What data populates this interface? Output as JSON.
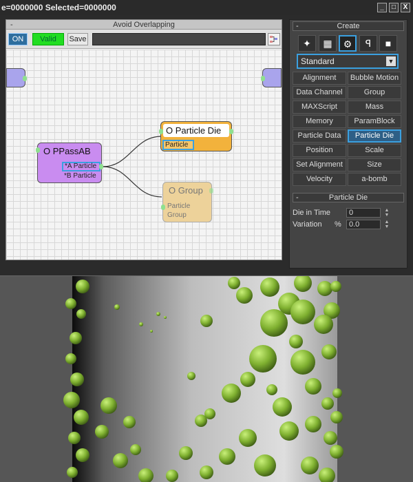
{
  "window": {
    "status_text": "e=0000000  Selected=0000000",
    "buttons": [
      "_",
      "□",
      "X"
    ]
  },
  "editor": {
    "title": "Avoid Overlapping",
    "collapse_symbol": "-",
    "on_label": "ON",
    "valid_label": "Valid",
    "save_label": "Save",
    "field_value": ""
  },
  "nodes": {
    "pass": {
      "title": "O PPassAB",
      "port_a": "*A Particle",
      "port_b": "*B Particle"
    },
    "die": {
      "title": "O Particle Die",
      "port": "Particle"
    },
    "group": {
      "title": "O Group",
      "port_line1": "Particle",
      "port_line2": "Group"
    }
  },
  "create": {
    "title": "Create",
    "collapse_symbol": "-",
    "icons": [
      "particle-icon",
      "table-icon",
      "gear-icon",
      "wrench-icon",
      "cube-icon"
    ],
    "dropdown_value": "Standard",
    "operators": [
      {
        "label": "Alignment",
        "selected": false
      },
      {
        "label": "Bubble Motion",
        "selected": false
      },
      {
        "label": "Data Channel",
        "selected": false
      },
      {
        "label": "Group",
        "selected": false
      },
      {
        "label": "MAXScript",
        "selected": false
      },
      {
        "label": "Mass",
        "selected": false
      },
      {
        "label": "Memory",
        "selected": false
      },
      {
        "label": "ParamBlock",
        "selected": false
      },
      {
        "label": "Particle Data",
        "selected": false
      },
      {
        "label": "Particle Die",
        "selected": true
      },
      {
        "label": "Position",
        "selected": false
      },
      {
        "label": "Scale",
        "selected": false
      },
      {
        "label": "Set Alignment",
        "selected": false
      },
      {
        "label": "Size",
        "selected": false
      },
      {
        "label": "Velocity",
        "selected": false
      },
      {
        "label": "a-bomb",
        "selected": false
      }
    ]
  },
  "particle_die": {
    "title": "Particle Die",
    "collapse_symbol": "-",
    "die_in_time_label": "Die in Time",
    "die_in_time_value": "0",
    "variation_label": "Variation",
    "variation_unit": "%",
    "variation_value": "0.0"
  },
  "colors": {
    "selection_blue": "#3aa0e0",
    "valid_green": "#22dd22",
    "pass_node": "#c98cf0",
    "die_node": "#f2b23c",
    "group_node": "#edd29a",
    "particle_green": "#7fb030"
  }
}
